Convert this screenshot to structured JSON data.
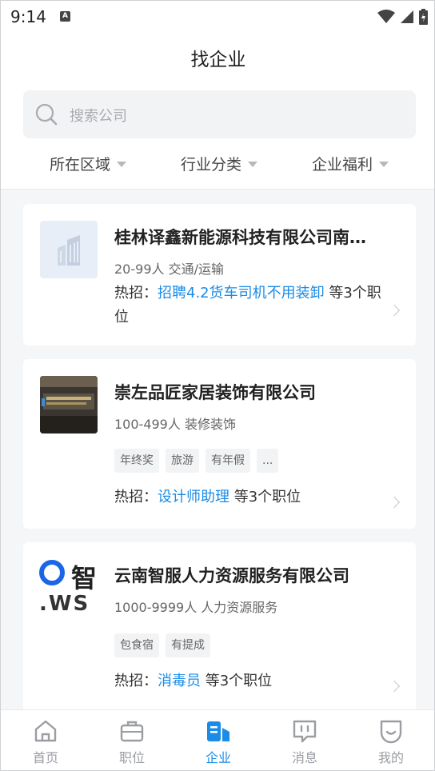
{
  "status": {
    "time": "9:14",
    "a_badge": "A"
  },
  "header": {
    "title": "找企业",
    "search": {
      "placeholder": "搜索公司"
    },
    "filters": [
      "所在区域",
      "行业分类",
      "企业福利"
    ]
  },
  "companies": [
    {
      "name": "桂林译鑫新能源科技有限公司南…",
      "meta": "20-99人  交通/运输",
      "hire_prefix": "热招：",
      "hire_job": "招聘4.2货车司机不用装卸",
      "hire_suffix": " 等3个职位",
      "tags": []
    },
    {
      "name": "崇左品匠家居装饰有限公司",
      "meta": "100-499人  装修装饰",
      "hire_prefix": "热招：",
      "hire_job": "设计师助理",
      "hire_suffix": " 等3个职位",
      "tags": [
        "年终奖",
        "旅游",
        "有年假",
        "..."
      ]
    },
    {
      "name": "云南智服人力资源服务有限公司",
      "meta": "1000-9999人  人力资源服务",
      "hire_prefix": "热招：",
      "hire_job": "消毒员",
      "hire_suffix": " 等3个职位",
      "tags": [
        "包食宿",
        "有提成"
      ],
      "logo_text": {
        "char": "智",
        "letters": ".WS"
      }
    }
  ],
  "tabbar": {
    "items": [
      {
        "label": "首页",
        "icon": "home-icon",
        "active": false
      },
      {
        "label": "职位",
        "icon": "briefcase-icon",
        "active": false
      },
      {
        "label": "企业",
        "icon": "company-icon",
        "active": true
      },
      {
        "label": "消息",
        "icon": "message-icon",
        "active": false
      },
      {
        "label": "我的",
        "icon": "profile-icon",
        "active": false
      }
    ]
  },
  "colors": {
    "accent": "#1a8be6",
    "text": "#222222",
    "muted": "#666666",
    "background": "#f5f6f8"
  }
}
